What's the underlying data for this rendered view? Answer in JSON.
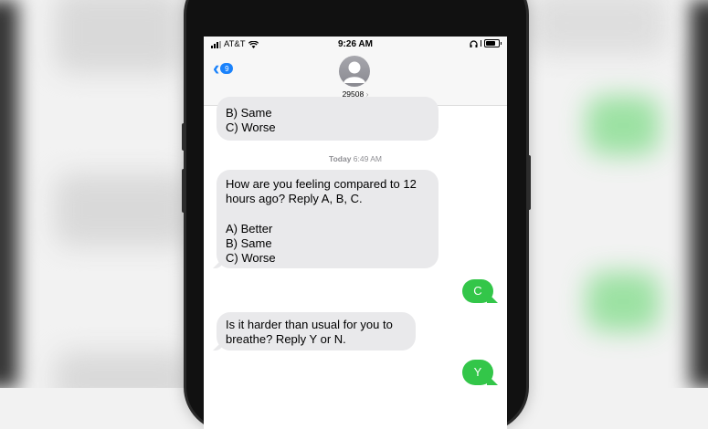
{
  "status_bar": {
    "carrier": "AT&T",
    "time": "9:26 AM"
  },
  "header": {
    "back_count": "9",
    "contact_number": "29508",
    "contact_chevron": "›"
  },
  "messages": [
    {
      "direction": "incoming",
      "text": "B) Same\nC) Worse"
    },
    {
      "direction": "timestamp",
      "day": "Today",
      "time": "6:49 AM"
    },
    {
      "direction": "incoming",
      "text": "How are you feeling compared to 12\nhours ago? Reply A, B, C.\n\nA) Better\nB) Same\nC) Worse"
    },
    {
      "direction": "outgoing",
      "text": "C"
    },
    {
      "direction": "incoming",
      "text": "Is it harder than usual for you to\nbreathe? Reply Y or N."
    },
    {
      "direction": "outgoing",
      "text": "Y"
    }
  ],
  "colors": {
    "accent_blue": "#1a82fb",
    "outgoing_green": "#33c649",
    "incoming_gray": "#e9e9eb"
  },
  "icons": [
    "signal-icon",
    "wifi-icon",
    "headphones-icon",
    "battery-icon",
    "back-chevron-icon",
    "contact-avatar-icon"
  ]
}
